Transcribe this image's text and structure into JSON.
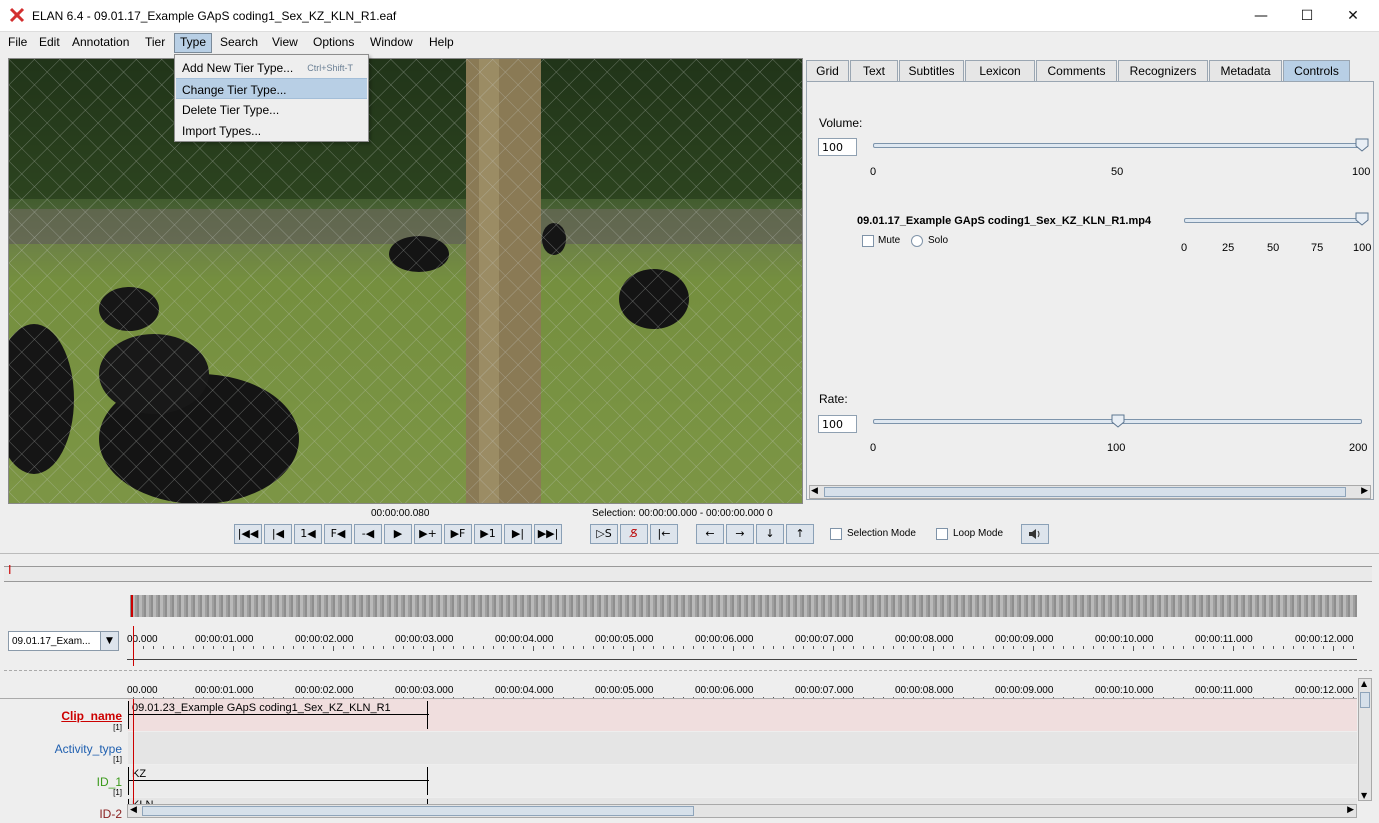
{
  "window": {
    "title": "ELAN 6.4 - 09.01.17_Example GApS coding1_Sex_KZ_KLN_R1.eaf",
    "minimize": "—",
    "maximize": "☐",
    "close": "✕"
  },
  "menubar": {
    "items": [
      "File",
      "Edit",
      "Annotation",
      "Tier",
      "Type",
      "Search",
      "View",
      "Options",
      "Window",
      "Help"
    ],
    "active": "Type"
  },
  "type_menu": {
    "items": [
      {
        "label": "Add New Tier Type...",
        "shortcut": "Ctrl+Shift-T"
      },
      {
        "label": "Change Tier Type...",
        "shortcut": ""
      },
      {
        "label": "Delete Tier Type...",
        "shortcut": ""
      },
      {
        "label": "Import Types...",
        "shortcut": ""
      }
    ],
    "highlighted": "Change Tier Type..."
  },
  "tabs": {
    "items": [
      "Grid",
      "Text",
      "Subtitles",
      "Lexicon",
      "Comments",
      "Recognizers",
      "Metadata",
      "Controls"
    ],
    "active": "Controls"
  },
  "controls": {
    "volume_label": "Volume:",
    "volume_value": "100",
    "volume_level": 1.0,
    "volume_ticks": [
      "0",
      "50",
      "100"
    ],
    "media_file": "09.01.17_Example GApS coding1_Sex_KZ_KLN_R1.mp4",
    "media_level": 1.0,
    "media_ticks": [
      "0",
      "25",
      "50",
      "75",
      "100"
    ],
    "mute_label": "Mute",
    "solo_label": "Solo",
    "rate_label": "Rate:",
    "rate_value": "100",
    "rate_level": 0.5,
    "rate_ticks": [
      "0",
      "100",
      "200"
    ]
  },
  "player": {
    "time": "00:00:00.080",
    "selection": "Selection: 00:00:00.000 - 00:00:00.000  0",
    "buttons": [
      "|◀◀",
      "|◀",
      "1◀",
      "F◀",
      "-◀",
      "▶",
      "▶+",
      "▶F",
      "▶1",
      "▶|",
      "▶▶|"
    ],
    "sel_buttons": [
      "▷S",
      "S̸",
      "|←"
    ],
    "nav_buttons": [
      "←",
      "→",
      "↓",
      "↑"
    ],
    "selection_mode": "Selection Mode",
    "loop_mode": "Loop Mode",
    "speaker_icon": "speaker-icon"
  },
  "timeline": {
    "media_select": "09.01.17_Exam...",
    "ticks": [
      "00.000",
      "00:00:01.000",
      "00:00:02.000",
      "00:00:03.000",
      "00:00:04.000",
      "00:00:05.000",
      "00:00:06.000",
      "00:00:07.000",
      "00:00:08.000",
      "00:00:09.000",
      "00:00:10.000",
      "00:00:11.000",
      "00:00:12.000"
    ]
  },
  "tiers": [
    {
      "name": "Clip_name",
      "count": "[1]",
      "color": "#cc0000",
      "annotation": "09.01.23_Example GApS coding1_Sex_KZ_KLN_R1"
    },
    {
      "name": "Activity_type",
      "count": "[1]",
      "color": "#2060b0",
      "annotation": ""
    },
    {
      "name": "ID_1",
      "count": "[1]",
      "color": "#3a9a1a",
      "annotation": "KZ"
    },
    {
      "name": "ID-2",
      "count": "",
      "color": "#8a2020",
      "annotation": "KLN"
    }
  ]
}
